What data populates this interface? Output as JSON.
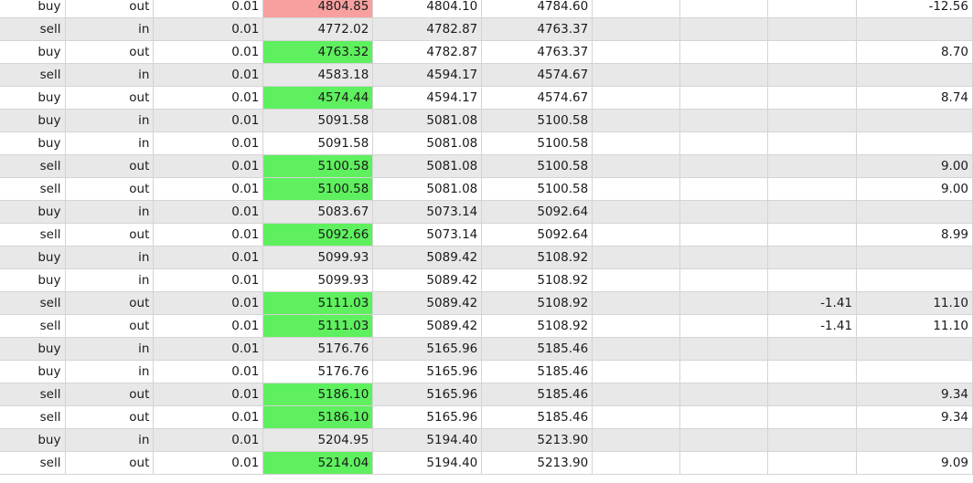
{
  "colors": {
    "profit_fill": "#5ef05e",
    "loss_fill": "#f8a0a0",
    "alt_row": "#e8e8e8",
    "grid_line": "#d4d4d4"
  },
  "rows": [
    {
      "type": "buy",
      "direction": "out",
      "volume": "0.01",
      "price": "4804.85",
      "sl": "4804.10",
      "tp": "4784.60",
      "commission": "",
      "swap": "",
      "fee": "",
      "profit": "-12.56",
      "highlight": "red"
    },
    {
      "type": "sell",
      "direction": "in",
      "volume": "0.01",
      "price": "4772.02",
      "sl": "4782.87",
      "tp": "4763.37",
      "commission": "",
      "swap": "",
      "fee": "",
      "profit": "",
      "highlight": ""
    },
    {
      "type": "buy",
      "direction": "out",
      "volume": "0.01",
      "price": "4763.32",
      "sl": "4782.87",
      "tp": "4763.37",
      "commission": "",
      "swap": "",
      "fee": "",
      "profit": "8.70",
      "highlight": "green"
    },
    {
      "type": "sell",
      "direction": "in",
      "volume": "0.01",
      "price": "4583.18",
      "sl": "4594.17",
      "tp": "4574.67",
      "commission": "",
      "swap": "",
      "fee": "",
      "profit": "",
      "highlight": ""
    },
    {
      "type": "buy",
      "direction": "out",
      "volume": "0.01",
      "price": "4574.44",
      "sl": "4594.17",
      "tp": "4574.67",
      "commission": "",
      "swap": "",
      "fee": "",
      "profit": "8.74",
      "highlight": "green"
    },
    {
      "type": "buy",
      "direction": "in",
      "volume": "0.01",
      "price": "5091.58",
      "sl": "5081.08",
      "tp": "5100.58",
      "commission": "",
      "swap": "",
      "fee": "",
      "profit": "",
      "highlight": ""
    },
    {
      "type": "buy",
      "direction": "in",
      "volume": "0.01",
      "price": "5091.58",
      "sl": "5081.08",
      "tp": "5100.58",
      "commission": "",
      "swap": "",
      "fee": "",
      "profit": "",
      "highlight": ""
    },
    {
      "type": "sell",
      "direction": "out",
      "volume": "0.01",
      "price": "5100.58",
      "sl": "5081.08",
      "tp": "5100.58",
      "commission": "",
      "swap": "",
      "fee": "",
      "profit": "9.00",
      "highlight": "green"
    },
    {
      "type": "sell",
      "direction": "out",
      "volume": "0.01",
      "price": "5100.58",
      "sl": "5081.08",
      "tp": "5100.58",
      "commission": "",
      "swap": "",
      "fee": "",
      "profit": "9.00",
      "highlight": "green"
    },
    {
      "type": "buy",
      "direction": "in",
      "volume": "0.01",
      "price": "5083.67",
      "sl": "5073.14",
      "tp": "5092.64",
      "commission": "",
      "swap": "",
      "fee": "",
      "profit": "",
      "highlight": ""
    },
    {
      "type": "sell",
      "direction": "out",
      "volume": "0.01",
      "price": "5092.66",
      "sl": "5073.14",
      "tp": "5092.64",
      "commission": "",
      "swap": "",
      "fee": "",
      "profit": "8.99",
      "highlight": "green"
    },
    {
      "type": "buy",
      "direction": "in",
      "volume": "0.01",
      "price": "5099.93",
      "sl": "5089.42",
      "tp": "5108.92",
      "commission": "",
      "swap": "",
      "fee": "",
      "profit": "",
      "highlight": ""
    },
    {
      "type": "buy",
      "direction": "in",
      "volume": "0.01",
      "price": "5099.93",
      "sl": "5089.42",
      "tp": "5108.92",
      "commission": "",
      "swap": "",
      "fee": "",
      "profit": "",
      "highlight": ""
    },
    {
      "type": "sell",
      "direction": "out",
      "volume": "0.01",
      "price": "5111.03",
      "sl": "5089.42",
      "tp": "5108.92",
      "commission": "",
      "swap": "",
      "fee": "-1.41",
      "profit": "11.10",
      "highlight": "green"
    },
    {
      "type": "sell",
      "direction": "out",
      "volume": "0.01",
      "price": "5111.03",
      "sl": "5089.42",
      "tp": "5108.92",
      "commission": "",
      "swap": "",
      "fee": "-1.41",
      "profit": "11.10",
      "highlight": "green"
    },
    {
      "type": "buy",
      "direction": "in",
      "volume": "0.01",
      "price": "5176.76",
      "sl": "5165.96",
      "tp": "5185.46",
      "commission": "",
      "swap": "",
      "fee": "",
      "profit": "",
      "highlight": ""
    },
    {
      "type": "buy",
      "direction": "in",
      "volume": "0.01",
      "price": "5176.76",
      "sl": "5165.96",
      "tp": "5185.46",
      "commission": "",
      "swap": "",
      "fee": "",
      "profit": "",
      "highlight": ""
    },
    {
      "type": "sell",
      "direction": "out",
      "volume": "0.01",
      "price": "5186.10",
      "sl": "5165.96",
      "tp": "5185.46",
      "commission": "",
      "swap": "",
      "fee": "",
      "profit": "9.34",
      "highlight": "green"
    },
    {
      "type": "sell",
      "direction": "out",
      "volume": "0.01",
      "price": "5186.10",
      "sl": "5165.96",
      "tp": "5185.46",
      "commission": "",
      "swap": "",
      "fee": "",
      "profit": "9.34",
      "highlight": "green"
    },
    {
      "type": "buy",
      "direction": "in",
      "volume": "0.01",
      "price": "5204.95",
      "sl": "5194.40",
      "tp": "5213.90",
      "commission": "",
      "swap": "",
      "fee": "",
      "profit": "",
      "highlight": ""
    },
    {
      "type": "sell",
      "direction": "out",
      "volume": "0.01",
      "price": "5214.04",
      "sl": "5194.40",
      "tp": "5213.90",
      "commission": "",
      "swap": "",
      "fee": "",
      "profit": "9.09",
      "highlight": "green"
    }
  ]
}
